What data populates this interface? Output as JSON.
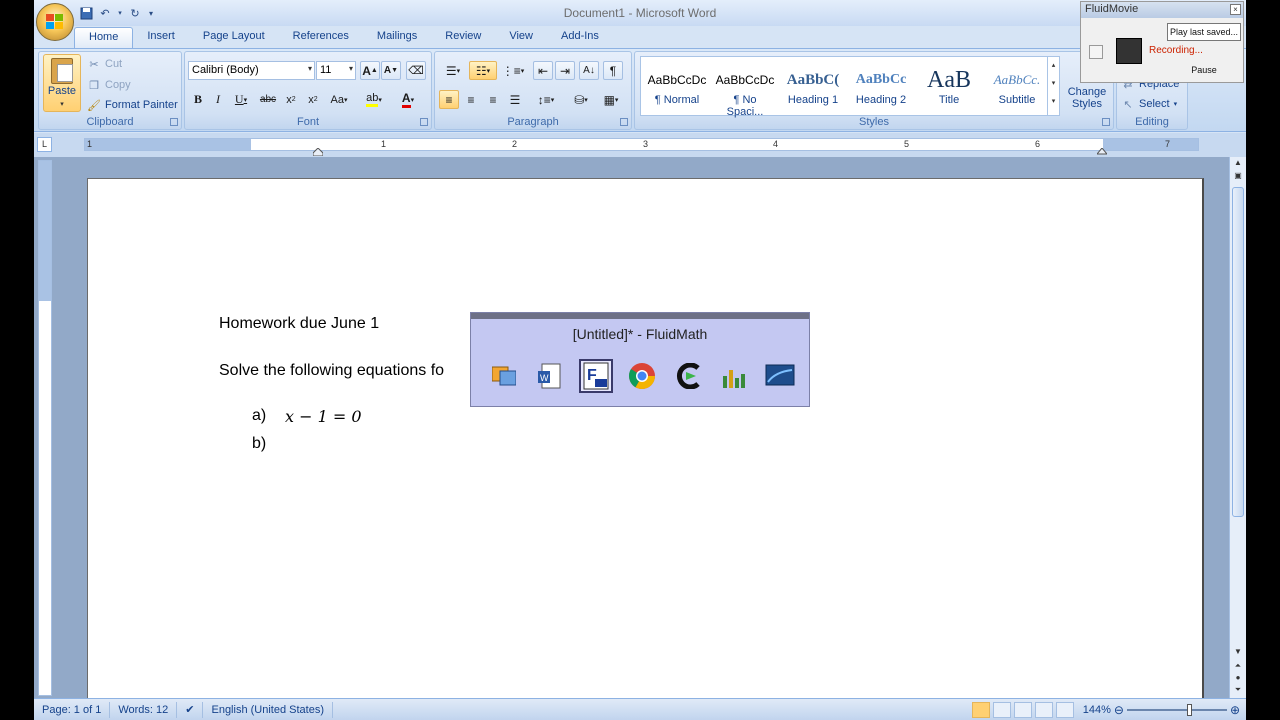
{
  "window": {
    "doc_name": "Document1",
    "app_name": "Microsoft Word"
  },
  "tabs": [
    "Home",
    "Insert",
    "Page Layout",
    "References",
    "Mailings",
    "Review",
    "View",
    "Add-Ins"
  ],
  "clipboard": {
    "paste": "Paste",
    "cut": "Cut",
    "copy": "Copy",
    "format_painter": "Format Painter",
    "label": "Clipboard"
  },
  "font": {
    "name": "Calibri (Body)",
    "size": "11",
    "label": "Font"
  },
  "paragraph": {
    "label": "Paragraph"
  },
  "styles": {
    "label": "Styles",
    "items": [
      {
        "sample": "AaBbCcDc",
        "name": "¶ Normal"
      },
      {
        "sample": "AaBbCcDc",
        "name": "¶ No Spaci..."
      },
      {
        "sample": "AaBbC(",
        "name": "Heading 1"
      },
      {
        "sample": "AaBbCc",
        "name": "Heading 2"
      },
      {
        "sample": "AaB",
        "name": "Title"
      },
      {
        "sample": "AaBbCc.",
        "name": "Subtitle"
      }
    ],
    "change_styles": "Change Styles"
  },
  "editing": {
    "replace": "Replace",
    "select": "Select",
    "label": "Editing"
  },
  "ruler_numbers": [
    "1",
    "1",
    "2",
    "3",
    "4",
    "5",
    "6",
    "7"
  ],
  "document": {
    "line1": "Homework due June 1",
    "line2": "Solve the following equations fo",
    "item_a_label": "a)",
    "item_a_math": "x − 1 = 0",
    "item_b_label": "b)"
  },
  "status": {
    "page": "Page: 1 of 1",
    "words": "Words: 12",
    "language": "English (United States)",
    "zoom": "144%"
  },
  "fluidmovie": {
    "title": "FluidMovie",
    "play_last": "Play last saved...",
    "recording": "Recording...",
    "pause": "Pause"
  },
  "fluidmath": {
    "title": "[Untitled]* - FluidMath"
  },
  "colors": {
    "ribbon": "#d6e4f5",
    "accent": "#15428b",
    "recording": "#cc2200",
    "fluidmath_bg": "#c4c8f2"
  }
}
